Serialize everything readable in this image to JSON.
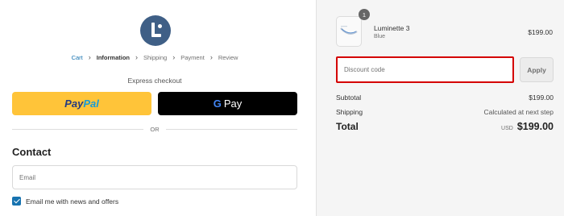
{
  "breadcrumb": {
    "items": [
      {
        "label": "Cart"
      },
      {
        "label": "Information"
      },
      {
        "label": "Shipping"
      },
      {
        "label": "Payment"
      },
      {
        "label": "Review"
      }
    ],
    "separator": "›"
  },
  "express": {
    "title": "Express checkout",
    "paypal_part1": "Pay",
    "paypal_part2": "Pal",
    "gpay_g": "G",
    "gpay_pay": "Pay"
  },
  "divider": {
    "label": "OR"
  },
  "contact": {
    "title": "Contact",
    "email_placeholder": "Email",
    "newsletter_label": "Email me with news and offers",
    "newsletter_checked": true
  },
  "cart": {
    "item": {
      "quantity": "1",
      "name": "Luminette 3",
      "variant": "Blue",
      "price": "$199.00"
    },
    "discount": {
      "placeholder": "Discount code",
      "apply_label": "Apply"
    },
    "summary": {
      "subtotal_label": "Subtotal",
      "subtotal_value": "$199.00",
      "shipping_label": "Shipping",
      "shipping_value": "Calculated at next step",
      "total_label": "Total",
      "currency": "USD",
      "total_value": "$199.00"
    }
  },
  "colors": {
    "accent": "#1773b0",
    "paypal_yellow": "#ffc439",
    "highlight_border": "#d40000",
    "sidebar_bg": "#f5f5f5"
  }
}
